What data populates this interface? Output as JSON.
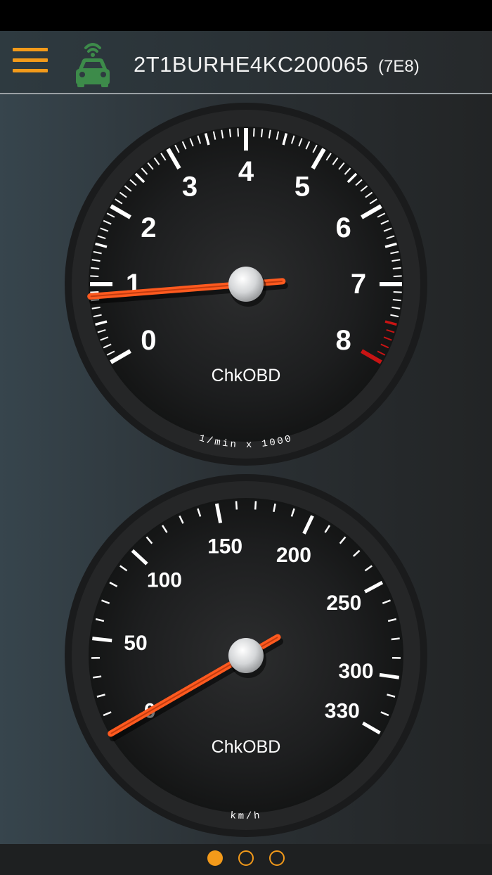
{
  "app_bar": {
    "vin": "2T1BURHE4KC200065",
    "ecu": "(7E8)",
    "menu_icon": "hamburger-menu-icon",
    "status_icon": "connected-car-icon"
  },
  "colors": {
    "accent": "#f39a1a",
    "connected": "#3d8b4a",
    "needle": "#ff5a1f",
    "redline": "#c81414"
  },
  "gauges": {
    "rpm": {
      "label": "ChkOBD",
      "unit": "1/min x 1000",
      "min": 0,
      "max": 8,
      "tick_labels": [
        "0",
        "1",
        "2",
        "3",
        "4",
        "5",
        "6",
        "7",
        "8"
      ],
      "redline_from": 7.5,
      "value": 0.85
    },
    "speed": {
      "label": "ChkOBD",
      "unit": "km/h",
      "min": 0,
      "max": 330,
      "tick_labels": [
        "0",
        "50",
        "100",
        "150",
        "200",
        "250",
        "300",
        "330"
      ],
      "value": 0
    }
  },
  "pager": {
    "pages": 3,
    "active": 1
  }
}
